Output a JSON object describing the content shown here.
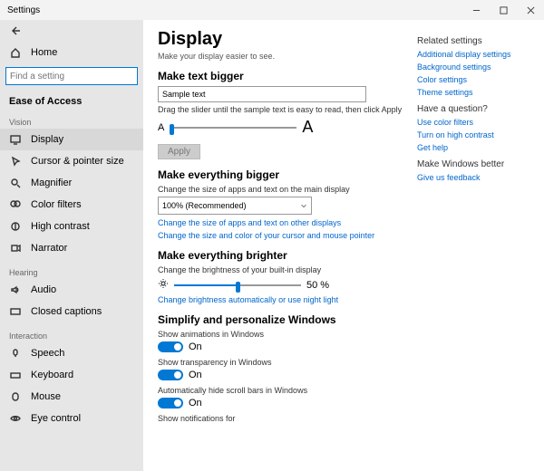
{
  "window": {
    "title": "Settings"
  },
  "sidebar": {
    "home": "Home",
    "search_placeholder": "Find a setting",
    "category": "Ease of Access",
    "groups": {
      "vision": "Vision",
      "hearing": "Hearing",
      "interaction": "Interaction"
    },
    "items": {
      "display": "Display",
      "cursor": "Cursor & pointer size",
      "magnifier": "Magnifier",
      "colorfilters": "Color filters",
      "highcontrast": "High contrast",
      "narrator": "Narrator",
      "audio": "Audio",
      "closedcaptions": "Closed captions",
      "speech": "Speech",
      "keyboard": "Keyboard",
      "mouse": "Mouse",
      "eyecontrol": "Eye control"
    }
  },
  "page": {
    "title": "Display",
    "subtitle": "Make your display easier to see.",
    "textbigger": {
      "heading": "Make text bigger",
      "sample": "Sample text",
      "hint": "Drag the slider until the sample text is easy to read, then click Apply",
      "smallA": "A",
      "bigA": "A",
      "apply": "Apply"
    },
    "evbigger": {
      "heading": "Make everything bigger",
      "hint": "Change the size of apps and text on the main display",
      "value": "100% (Recommended)",
      "link1": "Change the size of apps and text on other displays",
      "link2": "Change the size and color of your cursor and mouse pointer"
    },
    "brighter": {
      "heading": "Make everything brighter",
      "hint": "Change the brightness of your built-in display",
      "value": "50 %",
      "link": "Change brightness automatically or use night light"
    },
    "simplify": {
      "heading": "Simplify and personalize Windows",
      "anim": "Show animations in Windows",
      "trans": "Show transparency in Windows",
      "scroll": "Automatically hide scroll bars in Windows",
      "notif": "Show notifications for",
      "on": "On"
    }
  },
  "right": {
    "related_hdr": "Related settings",
    "related": [
      "Additional display settings",
      "Background settings",
      "Color settings",
      "Theme settings"
    ],
    "question_hdr": "Have a question?",
    "question": [
      "Use color filters",
      "Turn on high contrast",
      "Get help"
    ],
    "better_hdr": "Make Windows better",
    "feedback": "Give us feedback"
  }
}
